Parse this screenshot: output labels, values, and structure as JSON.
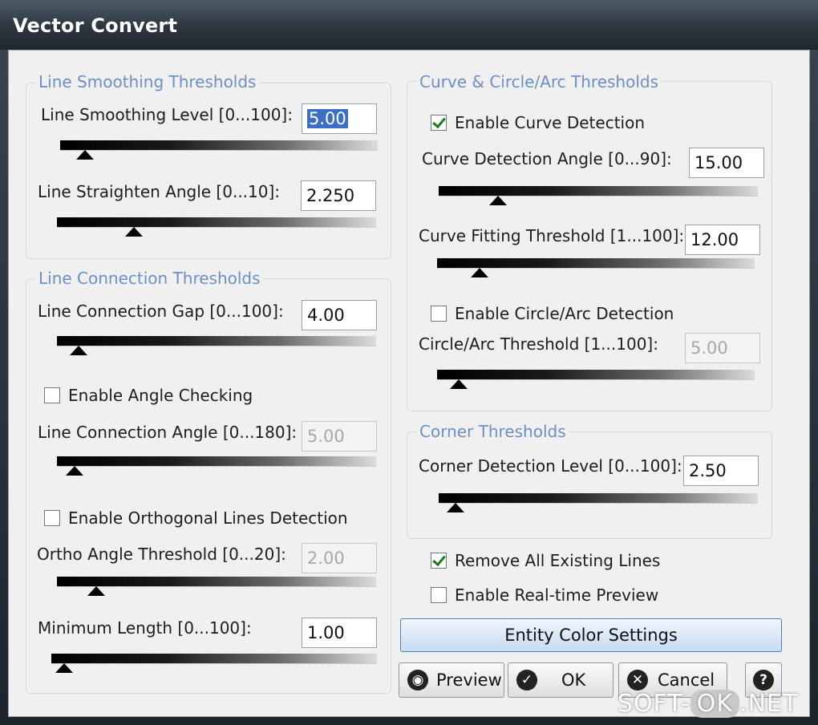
{
  "window": {
    "title": "Vector Convert"
  },
  "smoothing": {
    "legend": "Line Smoothing Thresholds",
    "level_label": "Line Smoothing Level [0...100]:",
    "level_value": "5.00",
    "level_slider": 0.05,
    "straighten_label": "Line Straighten Angle [0...10]:",
    "straighten_value": "2.250",
    "straighten_slider": 0.225
  },
  "connection": {
    "legend": "Line Connection Thresholds",
    "gap_label": "Line Connection Gap [0...100]:",
    "gap_value": "4.00",
    "gap_slider": 0.04,
    "angle_check_label": "Enable Angle Checking",
    "angle_check_checked": false,
    "angle_label": "Line Connection Angle [0...180]:",
    "angle_value": "5.00",
    "angle_slider": 0.028,
    "ortho_check_label": "Enable Orthogonal Lines Detection",
    "ortho_check_checked": false,
    "ortho_label": "Ortho Angle Threshold [0...20]:",
    "ortho_value": "2.00",
    "ortho_slider": 0.1,
    "minlen_label": "Minimum Length [0...100]:",
    "minlen_value": "1.00",
    "minlen_slider": 0.01
  },
  "curve": {
    "legend": "Curve & Circle/Arc Thresholds",
    "enable_curve_label": "Enable Curve Detection",
    "enable_curve_checked": true,
    "angle_label": "Curve Detection Angle [0...90]:",
    "angle_value": "15.00",
    "angle_slider": 0.167,
    "fitting_label": "Curve Fitting Threshold [1...100]:",
    "fitting_value": "12.00",
    "fitting_slider": 0.111,
    "enable_circle_label": "Enable Circle/Arc Detection",
    "enable_circle_checked": false,
    "circle_label": "Circle/Arc Threshold [1...100]:",
    "circle_value": "5.00",
    "circle_slider": 0.04
  },
  "corner": {
    "legend": "Corner Thresholds",
    "level_label": "Corner Detection Level [0...100]:",
    "level_value": "2.50",
    "level_slider": 0.025
  },
  "options": {
    "remove_lines_label": "Remove All Existing Lines",
    "remove_lines_checked": true,
    "realtime_label": "Enable Real-time Preview",
    "realtime_checked": false
  },
  "buttons": {
    "entity_color": "Entity Color Settings",
    "preview": "Preview",
    "ok": "OK",
    "cancel": "Cancel",
    "help_icon": "question-mark"
  },
  "watermark": {
    "left": "SOFT-",
    "pill": "OK",
    "right": ".NET"
  }
}
